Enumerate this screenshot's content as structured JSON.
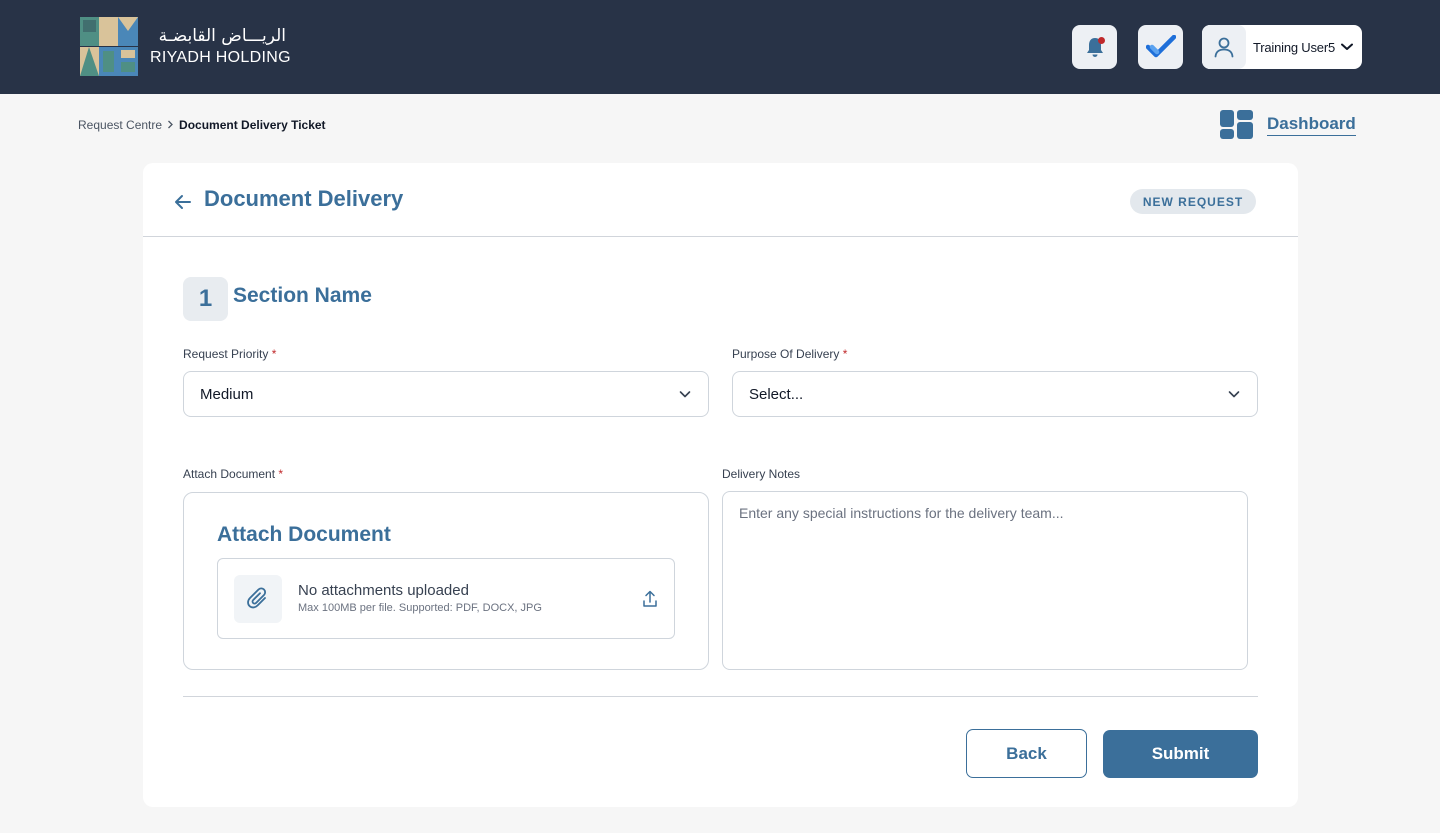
{
  "header": {
    "logo_arabic": "الريـــاض القابضـة",
    "logo_english": "RIYADH HOLDING",
    "user_name": "Training User5",
    "colors": {
      "topbar": "#283347",
      "accent": "#3b6f9a",
      "notification_dot": "#c0292b"
    }
  },
  "breadcrumb": {
    "items": [
      "Request Centre",
      "Document Delivery Ticket"
    ]
  },
  "dashboard_link": {
    "label": "Dashboard"
  },
  "page": {
    "title": "Document Delivery",
    "status_badge": "NEW REQUEST"
  },
  "section": {
    "number": "1",
    "title": "Section Name"
  },
  "fields": {
    "request_priority": {
      "label": "Request Priority",
      "required_mark": "*",
      "value": "Medium"
    },
    "purpose_of_delivery": {
      "label": "Purpose Of Delivery",
      "required_mark": "*",
      "value": "Select..."
    },
    "attach_document": {
      "label": "Attach Document",
      "required_mark": "*",
      "heading": "Attach Document",
      "empty_text": "No attachments uploaded",
      "hint": "Max 100MB per file. Supported: PDF, DOCX, JPG"
    },
    "delivery_notes": {
      "label": "Delivery Notes",
      "value": "",
      "placeholder": "Enter any special instructions for the delivery team..."
    }
  },
  "actions": {
    "back_label": "Back",
    "submit_label": "Submit"
  }
}
